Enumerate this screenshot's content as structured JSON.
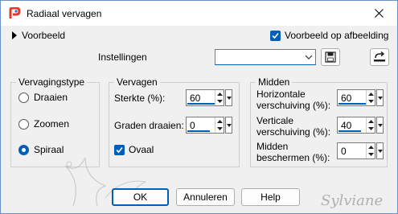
{
  "window": {
    "title": "Radiaal vervagen"
  },
  "top": {
    "preview_label": "Voorbeeld",
    "preview_on_image_label": "Voorbeeld op afbeelding",
    "preview_on_image_checked": true,
    "settings_label": "Instellingen",
    "settings_value": ""
  },
  "blur_type": {
    "title": "Vervagingstype",
    "options": [
      "Draaien",
      "Zoomen",
      "Spiraal"
    ],
    "selected": "Spiraal"
  },
  "blur": {
    "title": "Vervagen",
    "strength_label": "Sterkte (%):",
    "strength_value": "60",
    "rotation_label": "Graden draaien:",
    "rotation_value": "0",
    "oval_label": "Ovaal",
    "oval_checked": true
  },
  "center": {
    "title": "Midden",
    "h_offset_label_1": "Horizontale",
    "h_offset_label_2": "verschuiving (%):",
    "h_offset_value": "60",
    "v_offset_label_1": "Verticale",
    "v_offset_label_2": "verschuiving (%):",
    "v_offset_value": "40",
    "protect_label_1": "Midden",
    "protect_label_2": "beschermen (%):",
    "protect_value": "0"
  },
  "buttons": {
    "ok": "OK",
    "cancel": "Annuleren",
    "help": "Help"
  },
  "watermark_signature": "Sylviane",
  "colors": {
    "accent": "#005fb8",
    "dialog_bg": "#f0f0f0",
    "app_icon": "#e03a2f"
  }
}
